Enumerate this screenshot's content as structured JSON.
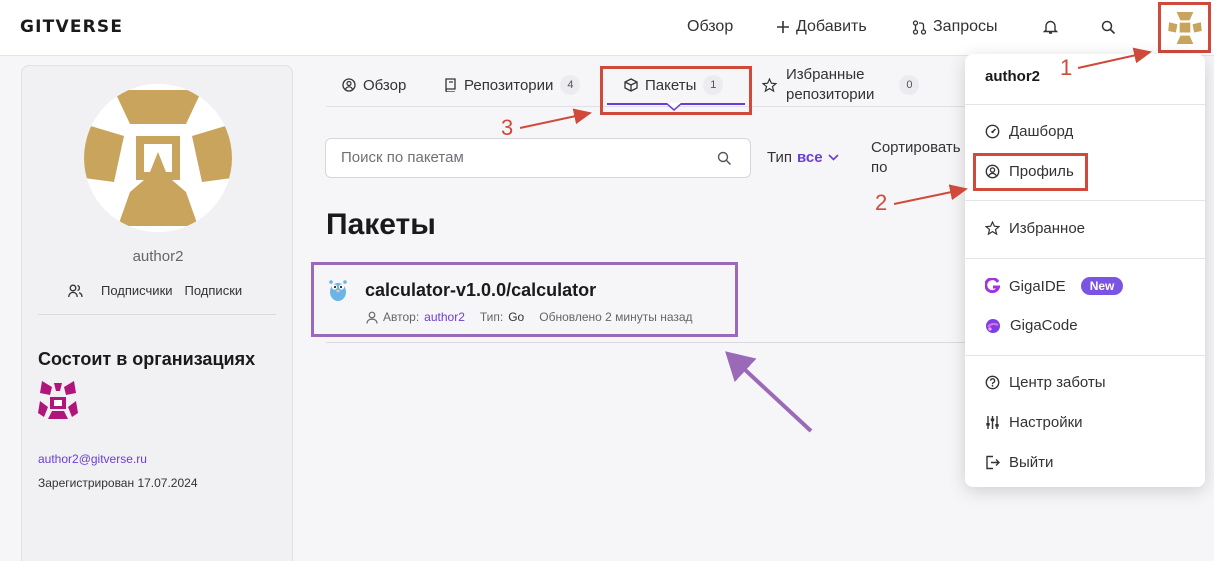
{
  "header": {
    "logo": "GITVERSE",
    "nav_overview": "Обзор",
    "nav_add": "Добавить",
    "nav_requests": "Запросы",
    "icons": [
      "plus-icon",
      "pull-request-icon",
      "bell-icon",
      "search-icon",
      "avatar"
    ]
  },
  "sidebar": {
    "username": "author2",
    "followers_label": "Подписчики",
    "following_label": "Подписки",
    "orgs_title": "Состоит в организациях",
    "email": "author2@gitverse.ru",
    "registered": "Зарегистрирован 17.07.2024"
  },
  "tabs": [
    {
      "label": "Обзор",
      "count": null
    },
    {
      "label": "Репозитории",
      "count": "4"
    },
    {
      "label": "Пакеты",
      "count": "1",
      "active": true
    },
    {
      "label_line1": "Избранные",
      "label_line2": "репозитории",
      "count": "0"
    }
  ],
  "search": {
    "placeholder": "Поиск по пакетам",
    "type_label": "Тип",
    "type_value": "все",
    "sort_label_line1": "Сортировать",
    "sort_label_line2": "по"
  },
  "main": {
    "title": "Пакеты",
    "package": {
      "name": "calculator-v1.0.0/calculator",
      "author_label": "Автор:",
      "author": "author2",
      "type_label": "Тип:",
      "type": "Go",
      "updated": "Обновлено 2 минуты назад"
    }
  },
  "dropdown": {
    "username": "author2",
    "items": [
      {
        "label": "Дашборд",
        "icon": "dashboard-icon"
      },
      {
        "label": "Профиль",
        "icon": "profile-icon"
      },
      {
        "label": "Избранное",
        "icon": "star-icon"
      },
      {
        "label": "GigaIDE",
        "icon": "gigaide-icon",
        "badge": "New"
      },
      {
        "label": "GigaCode",
        "icon": "gigacode-icon"
      },
      {
        "label": "Центр заботы",
        "icon": "help-icon"
      },
      {
        "label": "Настройки",
        "icon": "settings-icon"
      },
      {
        "label": "Выйти",
        "icon": "logout-icon"
      }
    ]
  },
  "annotations": [
    "1",
    "2",
    "3"
  ],
  "colors": {
    "accent": "#6a3ed6",
    "annotation_red": "#d04a3c",
    "annotation_purple": "#9a6ab8",
    "avatar_gold": "#c9a45c"
  }
}
